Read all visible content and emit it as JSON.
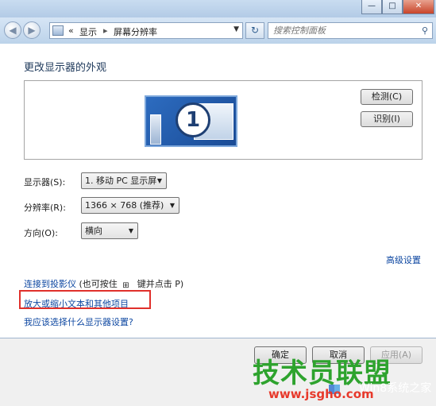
{
  "window": {
    "minimize_glyph": "—",
    "maximize_glyph": "□",
    "close_glyph": "✕"
  },
  "nav": {
    "back_glyph": "◀",
    "forward_glyph": "▶",
    "separator": "«",
    "breadcrumb": [
      "显示",
      "屏幕分辨率"
    ],
    "crumb_arrow": "▸",
    "dropdown_glyph": "▼",
    "refresh_glyph": "↻",
    "search_placeholder": "搜索控制面板",
    "search_glyph": "⚲"
  },
  "main": {
    "title": "更改显示器的外观",
    "monitor_number": "1",
    "detect_button": "检测(C)",
    "identify_button": "识别(I)",
    "display_label": "显示器(S):",
    "display_value": "1. 移动 PC 显示屏",
    "resolution_label": "分辨率(R):",
    "resolution_value": "1366 × 768 (推荐)",
    "orientation_label": "方向(O):",
    "orientation_value": "横向",
    "combo_arrow": "▼",
    "advanced_link": "高级设置",
    "projector_link": "连接到投影仪",
    "projector_hint_pre": " (也可按住 ",
    "windows_key_glyph": "⊞",
    "projector_hint_post": " 键并点击 P)",
    "enlarge_link": "放大或缩小文本和其他项目",
    "help_link": "我应该选择什么显示器设置?"
  },
  "footer": {
    "ok_button": "确定",
    "cancel_button": "取消",
    "apply_button": "应用(A)"
  },
  "watermark": {
    "brand": "技术员联盟",
    "url": "www.jsgho.com",
    "sub": "Win8系统之家"
  },
  "colors": {
    "link": "#0d47a1",
    "highlight_box": "#e0302b",
    "watermark_green": "#2ea32e",
    "watermark_red": "#e7392b"
  }
}
